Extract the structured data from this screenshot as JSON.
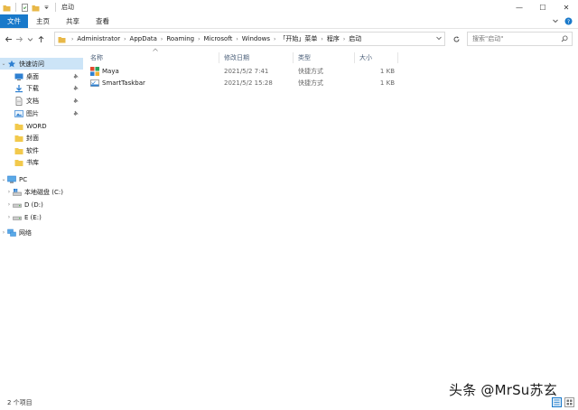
{
  "window": {
    "title": "启动",
    "controls": {
      "minimize": "—",
      "maximize": "☐",
      "close": "✕"
    }
  },
  "ribbon": {
    "tabs": [
      {
        "label": "文件",
        "active": true
      },
      {
        "label": "主页",
        "active": false
      },
      {
        "label": "共享",
        "active": false
      },
      {
        "label": "查看",
        "active": false
      }
    ]
  },
  "address": {
    "breadcrumbs": [
      "Administrator",
      "AppData",
      "Roaming",
      "Microsoft",
      "Windows",
      "「开始」菜单",
      "程序",
      "启动"
    ]
  },
  "search": {
    "placeholder": "搜索\"启动\""
  },
  "nav": {
    "quick_access": "快速访问",
    "quick_items": [
      {
        "label": "桌面",
        "icon": "desktop-icon",
        "pinned": true
      },
      {
        "label": "下载",
        "icon": "download-icon",
        "pinned": true
      },
      {
        "label": "文档",
        "icon": "document-icon",
        "pinned": true
      },
      {
        "label": "图片",
        "icon": "picture-icon",
        "pinned": true
      },
      {
        "label": "WORD",
        "icon": "folder-icon",
        "pinned": false
      },
      {
        "label": "封面",
        "icon": "folder-icon",
        "pinned": false
      },
      {
        "label": "软件",
        "icon": "folder-icon",
        "pinned": false
      },
      {
        "label": "书库",
        "icon": "folder-icon",
        "pinned": false
      }
    ],
    "pc": "PC",
    "drives": [
      {
        "label": "本地磁盘 (C:)"
      },
      {
        "label": "D (D:)"
      },
      {
        "label": "E (E:)"
      }
    ],
    "network": "网络"
  },
  "file_list": {
    "columns": {
      "name": "名称",
      "date": "修改日期",
      "type": "类型",
      "size": "大小"
    },
    "rows": [
      {
        "name": "Maya",
        "date": "2021/5/2 7:41",
        "type": "快捷方式",
        "size": "1 KB",
        "icon": "maya-shortcut-icon"
      },
      {
        "name": "SmartTaskbar",
        "date": "2021/5/2 15:28",
        "type": "快捷方式",
        "size": "1 KB",
        "icon": "smarttaskbar-shortcut-icon"
      }
    ]
  },
  "status": {
    "item_count": "2 个项目"
  },
  "watermark": "头条 @MrSu苏玄",
  "colors": {
    "accent": "#1979ca",
    "selection": "#cce4f7",
    "folder": "#f2c94c"
  }
}
